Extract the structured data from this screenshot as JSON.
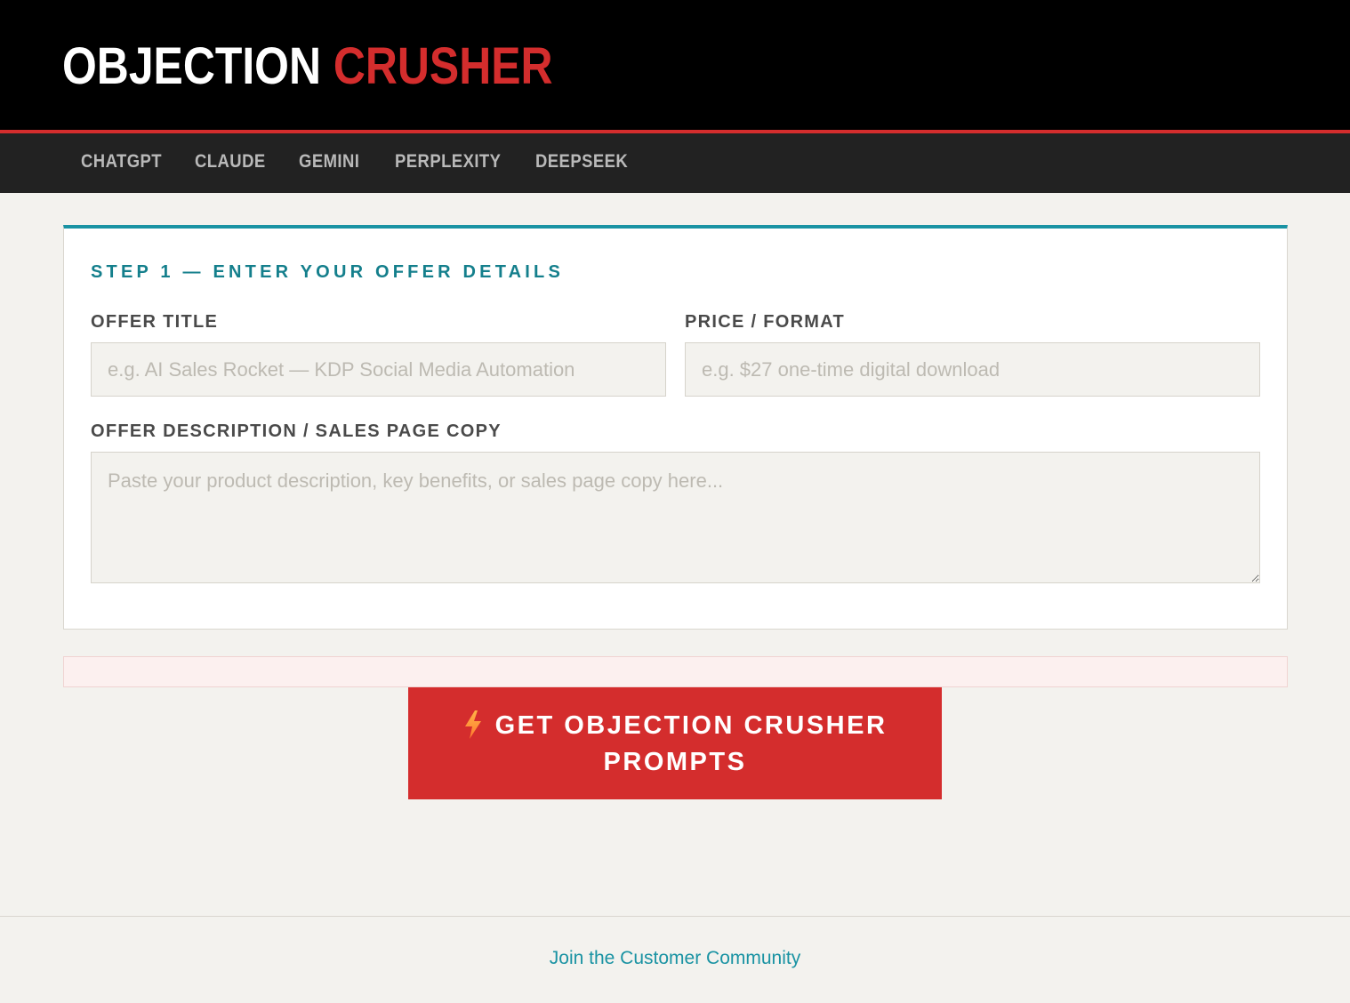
{
  "header": {
    "brand_part1": "OBJECTION",
    "brand_part2": "CRUSHER"
  },
  "nav": {
    "items": [
      {
        "label": "CHATGPT"
      },
      {
        "label": "CLAUDE"
      },
      {
        "label": "GEMINI"
      },
      {
        "label": "PERPLEXITY"
      },
      {
        "label": "DEEPSEEK"
      }
    ]
  },
  "form": {
    "step_title": "STEP 1 — ENTER YOUR OFFER DETAILS",
    "offer_title": {
      "label": "OFFER TITLE",
      "value": "",
      "placeholder": "e.g. AI Sales Rocket — KDP Social Media Automation"
    },
    "price_format": {
      "label": "PRICE / FORMAT",
      "value": "",
      "placeholder": "e.g. $27 one-time digital download"
    },
    "description": {
      "label": "OFFER DESCRIPTION / SALES PAGE COPY",
      "value": "",
      "placeholder": "Paste your product description, key benefits, or sales page copy here..."
    }
  },
  "cta": {
    "line1": "GET OBJECTION CRUSHER",
    "line2": "PROMPTS",
    "icon": "lightning-bolt-icon"
  },
  "footer": {
    "link_text": "Join the Customer Community"
  },
  "colors": {
    "header_bg": "#000000",
    "accent_red": "#d42d2d",
    "nav_bg": "#222222",
    "teal": "#1a93a3",
    "page_bg": "#f3f2ee"
  }
}
